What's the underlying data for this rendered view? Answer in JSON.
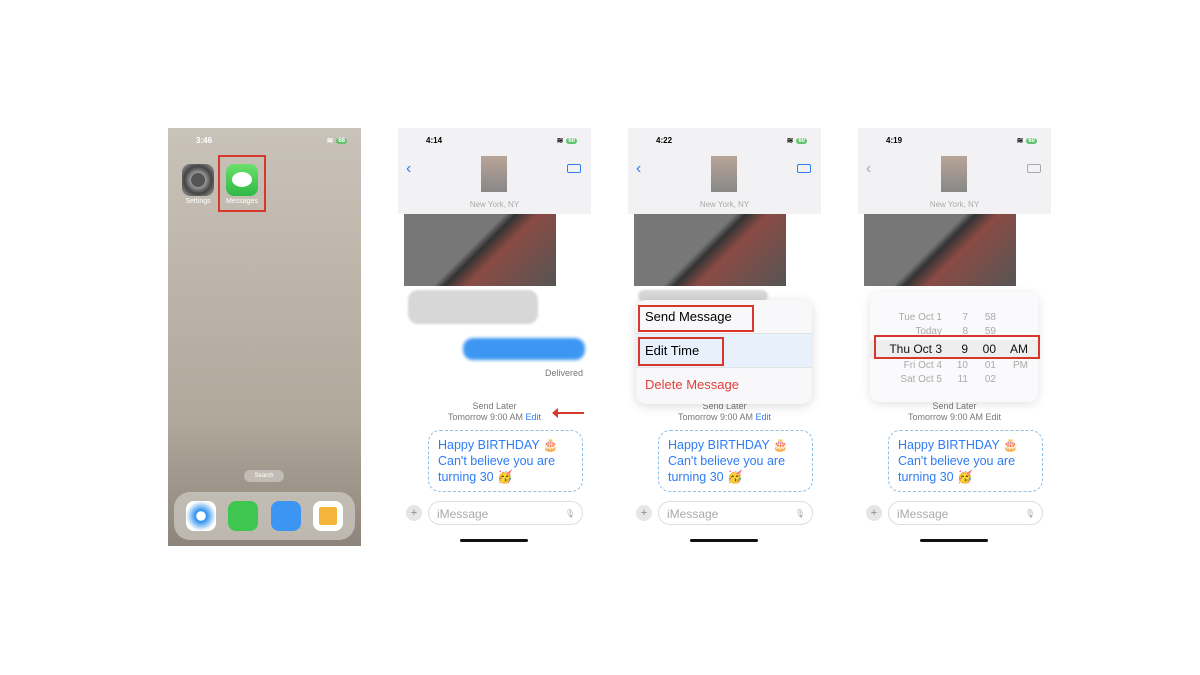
{
  "colors": {
    "accent": "#2f7cf6",
    "highlight": "#d8382c",
    "delete": "#e0413a"
  },
  "panel1": {
    "time": "3:46",
    "battery": "68",
    "apps": [
      {
        "label": "Settings",
        "icon": "gear-icon"
      },
      {
        "label": "Messages",
        "icon": "message-bubble-icon"
      }
    ],
    "search": "Search",
    "dock": [
      "safari-icon",
      "phone-icon",
      "mail-icon",
      "home-icon"
    ]
  },
  "panel2": {
    "time": "4:14",
    "battery": "60",
    "location": "New York, NY",
    "delivered": "Delivered",
    "send_later": "Send Later",
    "scheduled": "Tomorrow 9:00 AM",
    "edit": "Edit"
  },
  "panel3": {
    "time": "4:22",
    "battery": "60",
    "location": "New York, NY",
    "menu": [
      "Send Message",
      "Edit Time",
      "Delete Message"
    ],
    "send_later": "Send Later",
    "scheduled": "Tomorrow 9:00 AM",
    "edit": "Edit"
  },
  "panel4": {
    "time": "4:19",
    "battery": "60",
    "location": "New York, NY",
    "picker": {
      "rows": [
        [
          "Tue Oct 1",
          "7",
          "58",
          ""
        ],
        [
          "Today",
          "8",
          "59",
          ""
        ],
        [
          "Thu Oct 3",
          "9",
          "00",
          "AM"
        ],
        [
          "Fri Oct 4",
          "10",
          "01",
          "PM"
        ],
        [
          "Sat Oct 5",
          "11",
          "02",
          ""
        ]
      ]
    },
    "send_later": "Send Later",
    "scheduled": "Tomorrow 9:00 AM",
    "edit": "Edit"
  },
  "message": {
    "line1": "Happy BIRTHDAY 🎂",
    "line2": "Can't believe you are",
    "line3": "turning 30 🥳"
  },
  "input": {
    "placeholder": "iMessage"
  }
}
